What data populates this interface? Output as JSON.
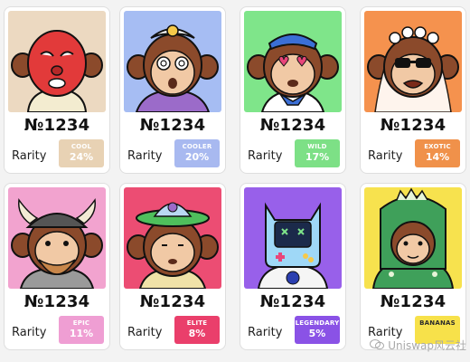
{
  "cards": [
    {
      "number": "№1234",
      "rarity_label": "Rarity",
      "tier": "COOL",
      "percent": "24%",
      "badge_color": "#e8d2b4",
      "art_bg": "#ecd9c1",
      "theme": "red-mask-icon"
    },
    {
      "number": "№1234",
      "rarity_label": "Rarity",
      "tier": "COOLER",
      "percent": "20%",
      "badge_color": "#a8b9f0",
      "art_bg": "#a6bdf3",
      "theme": "egg-hat-icon"
    },
    {
      "number": "№1234",
      "rarity_label": "Rarity",
      "tier": "WILD",
      "percent": "17%",
      "badge_color": "#7de086",
      "art_bg": "#7fe58a",
      "theme": "sailor-hat-icon"
    },
    {
      "number": "№1234",
      "rarity_label": "Rarity",
      "tier": "EXOTIC",
      "percent": "14%",
      "badge_color": "#f0914a",
      "art_bg": "#f5924e",
      "theme": "flower-crown-icon"
    },
    {
      "number": "№1234",
      "rarity_label": "Rarity",
      "tier": "EPIC",
      "percent": "11%",
      "badge_color": "#ef9ed3",
      "art_bg": "#f2a3cf",
      "theme": "viking-helmet-icon"
    },
    {
      "number": "№1234",
      "rarity_label": "Rarity",
      "tier": "ELITE",
      "percent": "8%",
      "badge_color": "#ea3f6b",
      "art_bg": "#ec4d73",
      "theme": "ufo-hat-icon"
    },
    {
      "number": "№1234",
      "rarity_label": "Rarity",
      "tier": "LEGENDARY",
      "percent": "5%",
      "badge_color": "#8a52e6",
      "art_bg": "#9860ea",
      "theme": "astronaut-icon"
    },
    {
      "number": "№1234",
      "rarity_label": "Rarity",
      "tier": "BANANAS",
      "percent": "",
      "badge_color": "#f7e14a",
      "art_bg": "#f7e24e",
      "theme": "dino-suit-icon"
    }
  ],
  "watermark": "Uniswap风云社"
}
